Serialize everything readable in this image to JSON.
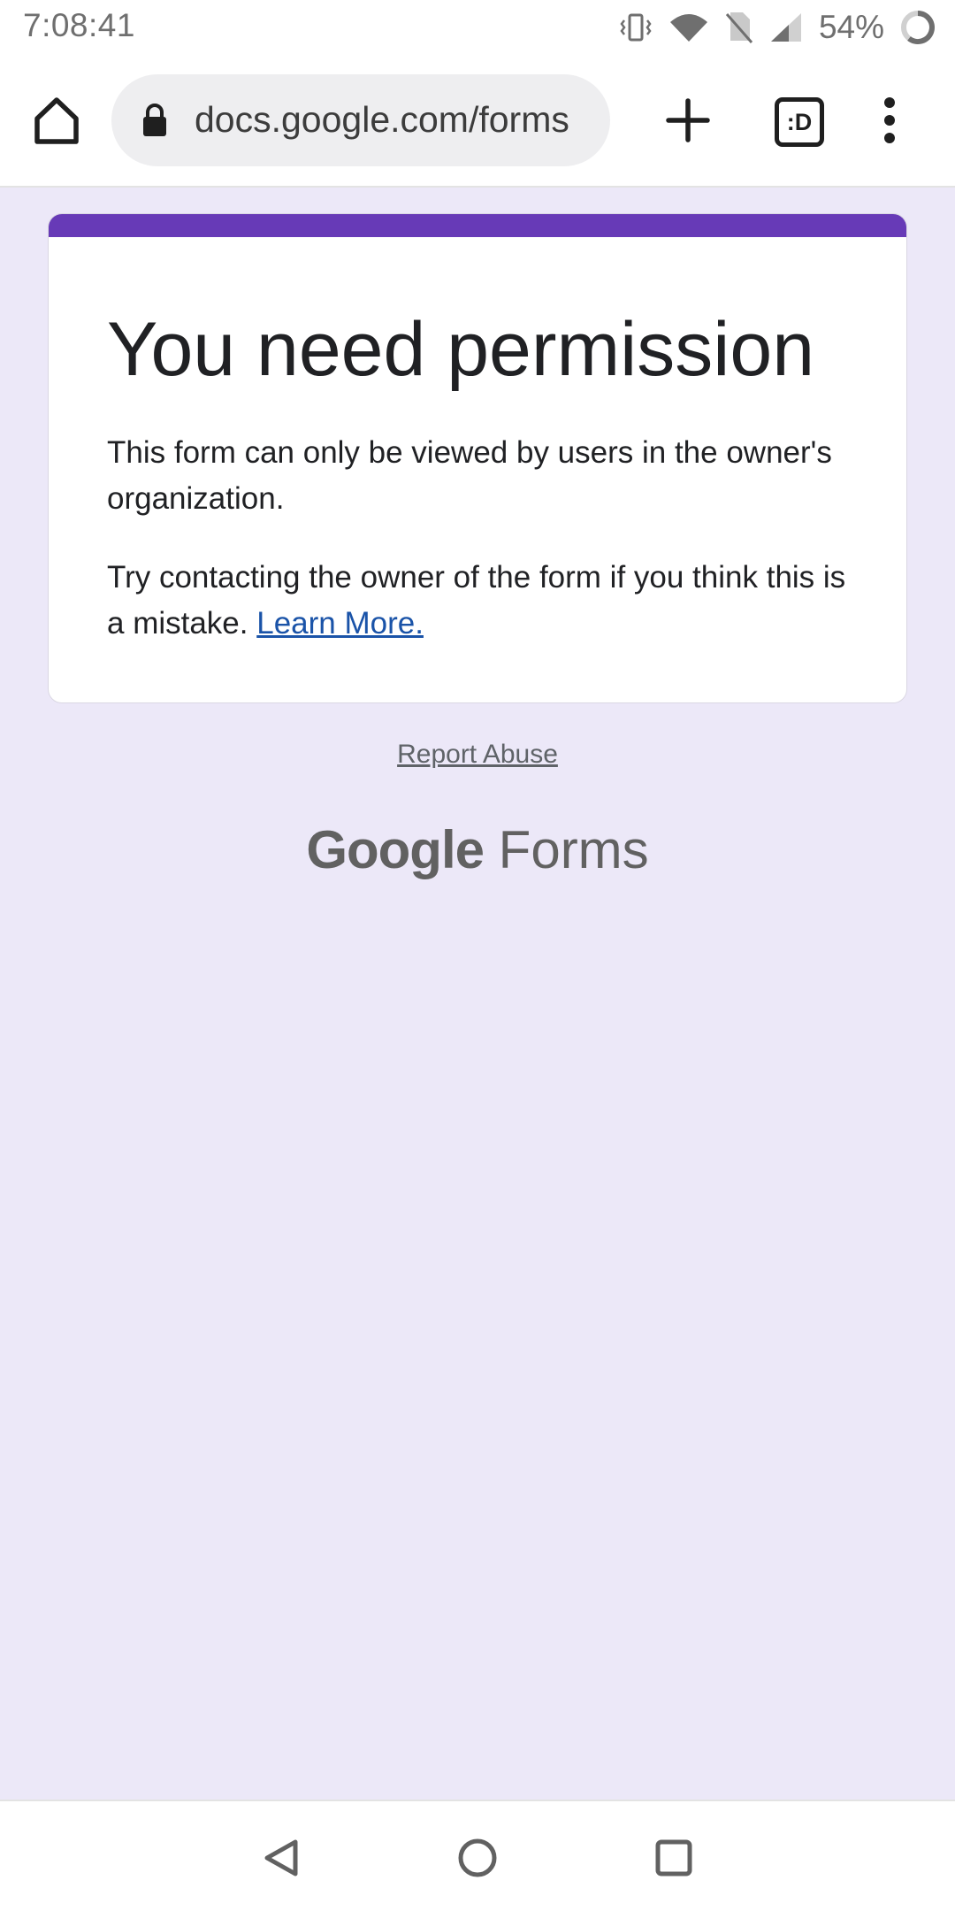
{
  "status_bar": {
    "time": "7:08:41",
    "battery": "54%",
    "icons": [
      "vibrate-icon",
      "wifi-icon",
      "no-sim-icon",
      "signal-icon",
      "battery-icon"
    ]
  },
  "browser": {
    "url": "docs.google.com/forms",
    "tabs_label": ":D",
    "icons": [
      "home-icon",
      "lock-icon",
      "plus-icon",
      "tabs-icon",
      "more-vert-icon"
    ]
  },
  "card": {
    "title": "You need permission",
    "paragraph1": "This form can only be viewed by users in the owner's organization.",
    "paragraph2": "Try contacting the owner of the form if you think this is a mistake.",
    "learn_more": "Learn More."
  },
  "footer": {
    "report_abuse": "Report Abuse",
    "logo_google": "Google",
    "logo_forms": "Forms"
  },
  "colors": {
    "accent": "#673ab7",
    "page_background": "#ece8f8",
    "link": "#1a53a8"
  },
  "nav_bar": {
    "icons": [
      "back-icon",
      "home-circle-icon",
      "recents-icon"
    ]
  }
}
